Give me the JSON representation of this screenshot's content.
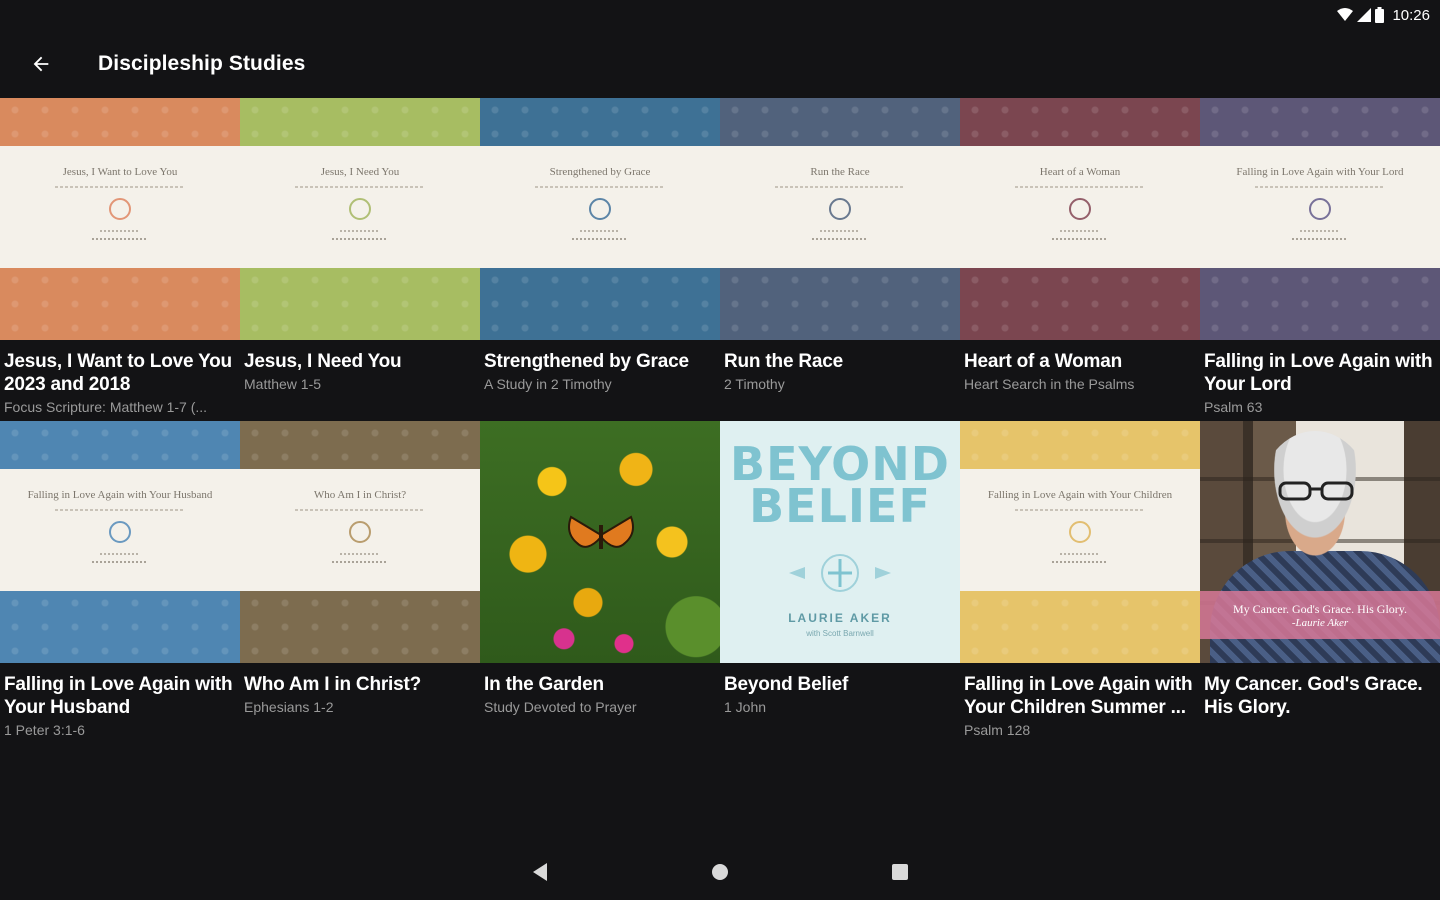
{
  "status": {
    "time": "10:26",
    "icons": [
      "wifi-icon",
      "signal-icon",
      "battery-icon"
    ]
  },
  "app_bar": {
    "back_icon": "arrow-left-icon",
    "title": "Discipleship Studies"
  },
  "studies": [
    {
      "title": "Jesus, I Want to Love You 2023 and 2018",
      "subtitle": "Focus Scripture: Matthew 1-7 (...",
      "cover_text": "Jesus, I Want to Love You",
      "color": "#d98a5e",
      "emblem_color": "#e08c6a"
    },
    {
      "title": "Jesus, I Need You",
      "subtitle": "Matthew 1-5",
      "cover_text": "Jesus, I Need You",
      "color": "#a7bd62",
      "emblem_color": "#a9b968"
    },
    {
      "title": "Strengthened by Grace",
      "subtitle": "A Study in 2 Timothy",
      "cover_text": "Strengthened by Grace",
      "color": "#3e7195",
      "emblem_color": "#4b79a0"
    },
    {
      "title": "Run the Race",
      "subtitle": "2 Timothy",
      "cover_text": "Run the Race",
      "color": "#51627c",
      "emblem_color": "#5a6c85"
    },
    {
      "title": "Heart of a Woman",
      "subtitle": "Heart Search in the Psalms",
      "cover_text": "Heart of a Woman",
      "color": "#7b4650",
      "emblem_color": "#8a4f5c"
    },
    {
      "title": "Falling in Love Again with Your Lord",
      "subtitle": "Psalm 63",
      "cover_text": "Falling in Love Again with Your Lord",
      "color": "#5d5777",
      "emblem_color": "#6a6390"
    },
    {
      "title": "Falling in Love Again with Your Husband",
      "subtitle": "1 Peter 3:1-6",
      "cover_text": "Falling in Love Again with Your Husband",
      "color": "#4f86b2",
      "emblem_color": "#5b8fbb"
    },
    {
      "title": "Who Am I in Christ?",
      "subtitle": "Ephesians 1-2",
      "cover_text": "Who Am I in Christ?",
      "color": "#7d6c4f",
      "emblem_color": "#b39460"
    },
    {
      "title": "In the Garden",
      "subtitle": "Study Devoted to Prayer"
    },
    {
      "title": "Beyond Belief",
      "subtitle": "1 John",
      "cover_word1": "BEYOND",
      "cover_word2": "BELIEF",
      "cover_author": "LAURIE AKER",
      "cover_with": "with Scott Barnwell"
    },
    {
      "title": "Falling in Love Again with Your Children Summer ...",
      "subtitle": "Psalm 128",
      "cover_text": "Falling in Love Again with Your Children",
      "color": "#e6c46a",
      "emblem_color": "#e0b864"
    },
    {
      "title": "My Cancer. God's Grace. His Glory.",
      "subtitle": "",
      "banner_line1": "My Cancer. God's Grace. His Glory.",
      "banner_line2": "-Laurie Aker"
    }
  ],
  "nav": {
    "back": "nav-back-icon",
    "home": "nav-home-icon",
    "recents": "nav-recents-icon"
  }
}
